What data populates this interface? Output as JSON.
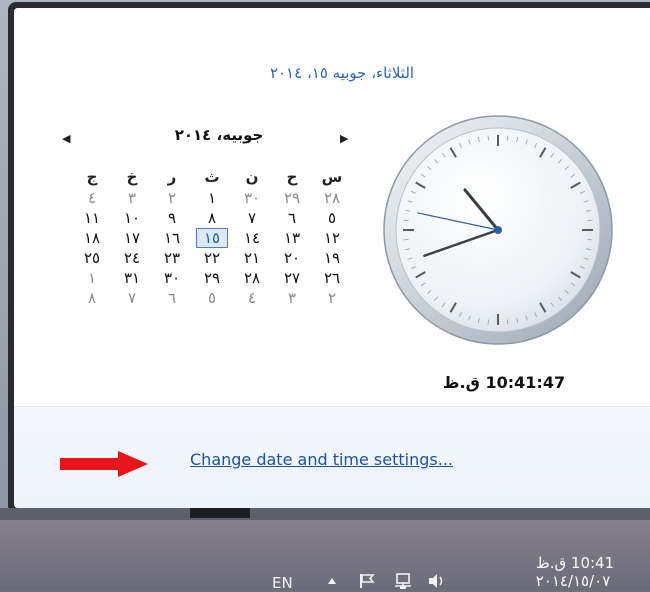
{
  "header": {
    "full_date": "الثلاثاء، جوبيه ١٥، ٢٠١٤"
  },
  "calendar": {
    "prev_label": "◀",
    "next_label": "▶",
    "month_title": "جوبيه، ٢٠١٤",
    "weekdays": [
      "ج",
      "خ",
      "ر",
      "ث",
      "ن",
      "ح",
      "س"
    ],
    "rows": [
      [
        {
          "t": "٤",
          "o": 1
        },
        {
          "t": "٣",
          "o": 1
        },
        {
          "t": "٢",
          "o": 1
        },
        {
          "t": "١",
          "o": 0
        },
        {
          "t": "٣٠",
          "o": 1
        },
        {
          "t": "٢٩",
          "o": 1
        },
        {
          "t": "٢٨",
          "o": 1
        }
      ],
      [
        {
          "t": "١١",
          "o": 0
        },
        {
          "t": "١٠",
          "o": 0
        },
        {
          "t": "٩",
          "o": 0
        },
        {
          "t": "٨",
          "o": 0
        },
        {
          "t": "٧",
          "o": 0
        },
        {
          "t": "٦",
          "o": 0
        },
        {
          "t": "٥",
          "o": 0
        }
      ],
      [
        {
          "t": "١٨",
          "o": 0
        },
        {
          "t": "١٧",
          "o": 0
        },
        {
          "t": "١٦",
          "o": 0
        },
        {
          "t": "١٥",
          "o": 0,
          "today": 1
        },
        {
          "t": "١٤",
          "o": 0
        },
        {
          "t": "١٣",
          "o": 0
        },
        {
          "t": "١٢",
          "o": 0
        }
      ],
      [
        {
          "t": "٢٥",
          "o": 0
        },
        {
          "t": "٢٤",
          "o": 0
        },
        {
          "t": "٢٣",
          "o": 0
        },
        {
          "t": "٢٢",
          "o": 0
        },
        {
          "t": "٢١",
          "o": 0
        },
        {
          "t": "٢٠",
          "o": 0
        },
        {
          "t": "١٩",
          "o": 0
        }
      ],
      [
        {
          "t": "١",
          "o": 1
        },
        {
          "t": "٣١",
          "o": 0
        },
        {
          "t": "٣٠",
          "o": 0
        },
        {
          "t": "٢٩",
          "o": 0
        },
        {
          "t": "٢٨",
          "o": 0
        },
        {
          "t": "٢٧",
          "o": 0
        },
        {
          "t": "٢٦",
          "o": 0
        }
      ],
      [
        {
          "t": "٨",
          "o": 1
        },
        {
          "t": "٧",
          "o": 1
        },
        {
          "t": "٦",
          "o": 1
        },
        {
          "t": "٥",
          "o": 1
        },
        {
          "t": "٤",
          "o": 1
        },
        {
          "t": "٣",
          "o": 1
        },
        {
          "t": "٢",
          "o": 1
        }
      ]
    ]
  },
  "clock": {
    "time_text": "10:41:47 ق.ظ",
    "hour": 10,
    "minute": 41,
    "second": 47
  },
  "footer": {
    "change_link": "Change date and time settings..."
  },
  "taskbar": {
    "language": "EN",
    "time": "10:41 ق.ظ",
    "date": "٢٠١٤/١٥/٠٧",
    "icons": [
      "show-hidden-icons-icon",
      "action-center-flag-icon",
      "network-icon",
      "volume-icon"
    ]
  },
  "colors": {
    "accent": "#2c67b5",
    "link": "#1d53a4",
    "arrow": "#e8141a"
  }
}
